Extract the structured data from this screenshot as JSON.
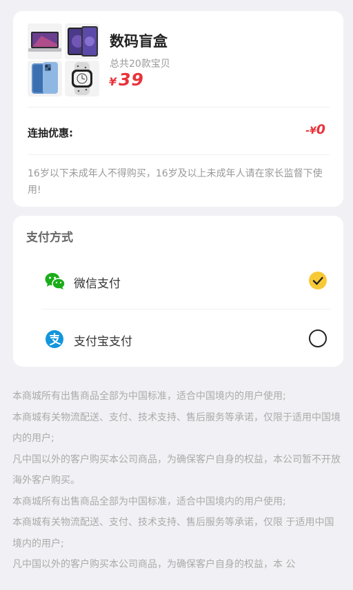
{
  "product": {
    "title": "数码盲盒",
    "subtitle": "总共20款宝贝",
    "price_symbol": "¥",
    "price": "39",
    "thumbnails": [
      {
        "icon": "laptop-icon"
      },
      {
        "icon": "tablet-icon"
      },
      {
        "icon": "phone-icon"
      },
      {
        "icon": "watch-icon"
      }
    ]
  },
  "discount": {
    "label": "连抽优惠:",
    "symbol": "-¥",
    "value": "0"
  },
  "age_note": "16岁以下未成年人不得购买，16岁及以上未成年人请在家长监督下使用!",
  "payment": {
    "title": "支付方式",
    "methods": [
      {
        "label": "微信支付",
        "icon": "wechat-icon",
        "selected": true
      },
      {
        "label": "支付宝支付",
        "icon": "alipay-icon",
        "selected": false
      }
    ]
  },
  "notice": [
    "本商城所有出售商品全部为中国标准，适合中国境内的用户使用;",
    "本商城有关物流配送、支付、技术支持、售后服务等承诺，仅限于适用中国境内的用户;",
    "凡中国以外的客户购买本公司商品，为确保客户自身的权益，本公司暂不开放海外客户购买。",
    "本商城所有出售商品全部为中国标准，适合中国境内的用户使用;",
    "本商城有关物流配送、支付、技术支持、售后服务等承诺，仅限 于适用中国境内的用户;",
    "凡中国以外的客户购买本公司商品，为确保客户自身的权益，本 公"
  ],
  "colors": {
    "accent_red": "#e8333a",
    "check_yellow": "#f7c936",
    "wechat_green": "#1aad19",
    "alipay_blue": "#1296db",
    "background": "#f1f1f5"
  }
}
